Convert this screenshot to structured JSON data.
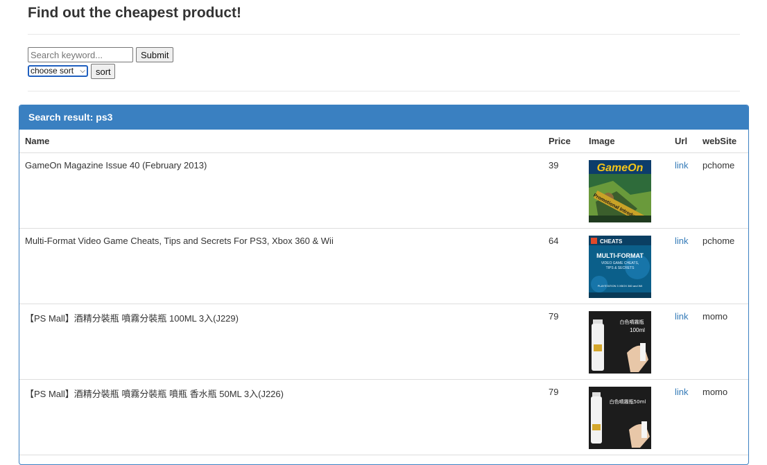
{
  "page": {
    "title": "Find out the cheapest product!"
  },
  "search": {
    "placeholder": "Search keyword...",
    "value": "",
    "submit_label": "Submit"
  },
  "sort": {
    "selected": "choose sort",
    "button_label": "sort"
  },
  "results": {
    "heading": "Search result: ps3",
    "columns": [
      "Name",
      "Price",
      "Image",
      "Url",
      "webSite"
    ],
    "rows": [
      {
        "name": "GameOn Magazine Issue 40 (February 2013)",
        "price": "39",
        "url_text": "link",
        "website": "pchome",
        "image": "gameon-magazine-cover"
      },
      {
        "name": "Multi-Format Video Game Cheats, Tips and Secrets For PS3, Xbox 360 & Wii",
        "price": "64",
        "url_text": "link",
        "website": "pchome",
        "image": "cheats-book-cover"
      },
      {
        "name": "【PS Mall】酒精分裝瓶 噴霧分裝瓶 100ML 3入(J229)",
        "price": "79",
        "url_text": "link",
        "website": "momo",
        "image": "spray-bottle-100ml",
        "image_text": [
          "白色噴霧瓶",
          "100ml"
        ]
      },
      {
        "name": "【PS Mall】酒精分裝瓶 噴霧分裝瓶 噴瓶 香水瓶 50ML 3入(J226)",
        "price": "79",
        "url_text": "link",
        "website": "momo",
        "image": "spray-bottle-50ml",
        "image_text": [
          "白色噴霧瓶50ml"
        ]
      }
    ]
  },
  "image_text": {
    "gameon_logo": "GameOn",
    "gameon_banner": "Promotional Introduction",
    "cheats_banner": "CHEATS",
    "cheats_title": "MULTI-FORMAT",
    "cheats_sub1": "VIDEO GAME CHEATS,",
    "cheats_sub2": "TIPS & SECRETS",
    "cheats_footer": "PLAYSTATION 3 XBOX 360 and Wii"
  }
}
